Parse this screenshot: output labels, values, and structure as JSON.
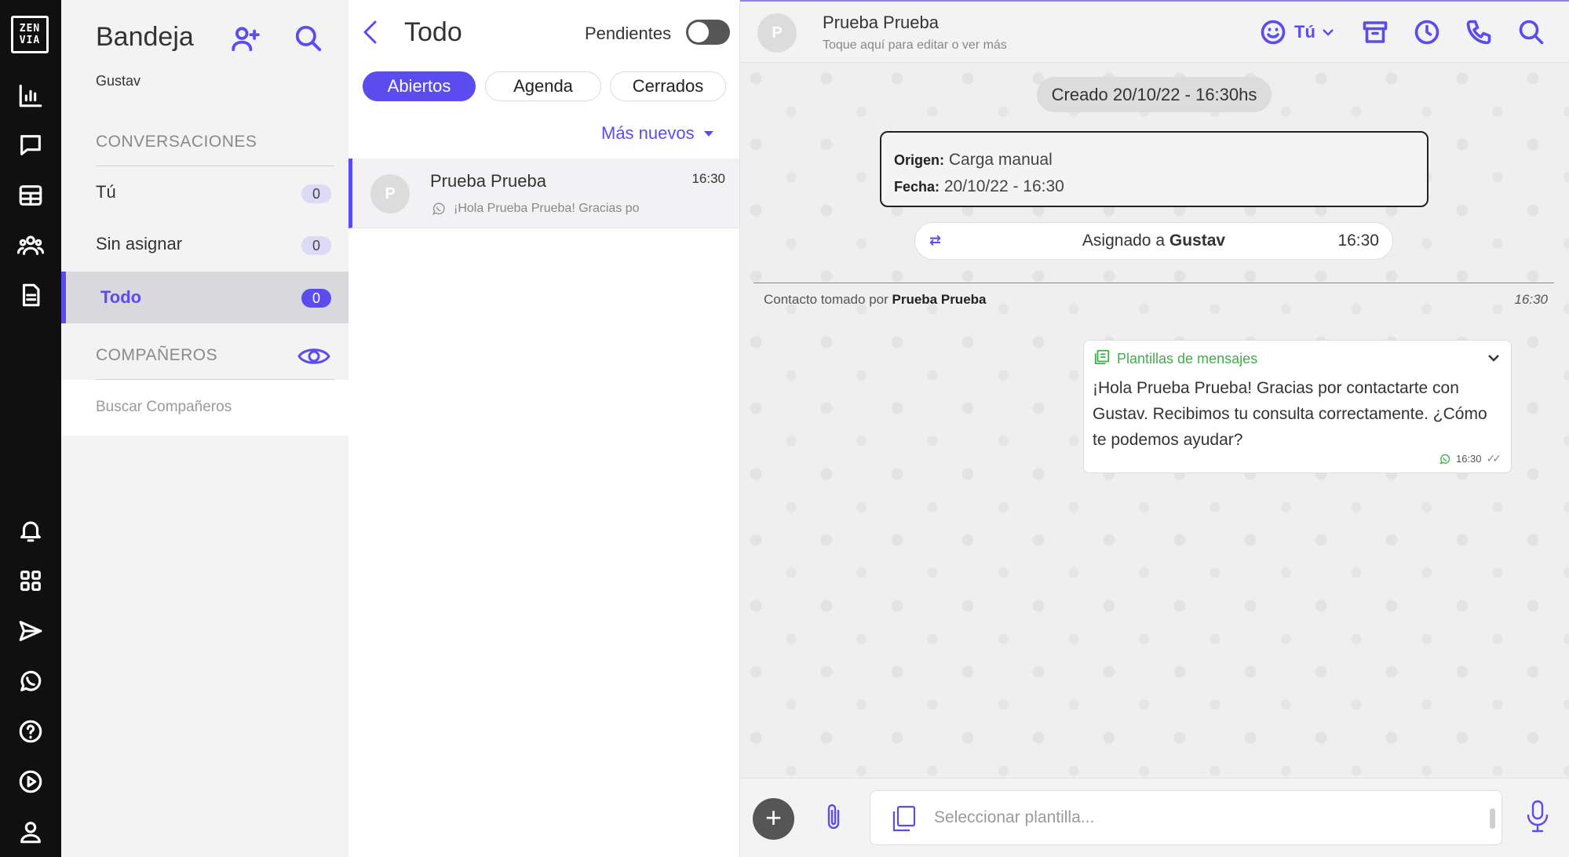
{
  "brand": {
    "logo_line1": "ZEN",
    "logo_line2": "VIA"
  },
  "rail": {
    "top_icons": [
      "logo-icon",
      "chart-icon",
      "chat-icon",
      "table-icon",
      "users-icon",
      "document-icon"
    ],
    "bottom_icons": [
      "bell-icon",
      "apps-icon",
      "send-icon",
      "whatsapp-icon",
      "help-icon",
      "play-icon",
      "user-icon"
    ]
  },
  "inbox": {
    "title": "Bandeja",
    "user": "Gustav",
    "conversations_header": "CONVERSACIONES",
    "items": [
      {
        "label": "Tú",
        "count": "0"
      },
      {
        "label": "Sin asignar",
        "count": "0"
      },
      {
        "label": "Todo",
        "count": "0"
      }
    ],
    "companions_header": "COMPAÑEROS",
    "search_companions": "Buscar Compañeros"
  },
  "list": {
    "title": "Todo",
    "pending_label": "Pendientes",
    "tabs": [
      {
        "label": "Abiertos"
      },
      {
        "label": "Agenda"
      },
      {
        "label": "Cerrados"
      }
    ],
    "sort_label": "Más nuevos",
    "conversation": {
      "initial": "P",
      "name": "Prueba Prueba",
      "time": "16:30",
      "preview": "¡Hola Prueba Prueba! Gracias po"
    }
  },
  "chat": {
    "initial": "P",
    "name": "Prueba Prueba",
    "subtitle": "Toque aquí para editar o ver más",
    "assignee_label": "Tú",
    "created": "Creado 20/10/22 - 16:30hs",
    "origin_label": "Origen:",
    "origin_value": "Carga manual",
    "date_label": "Fecha:",
    "date_value": "20/10/22 - 16:30",
    "assigned_prefix": "Asignado a",
    "assigned_name": "Gustav",
    "assigned_time": "16:30",
    "taken_prefix": "Contacto tomado por",
    "taken_name": "Prueba Prueba",
    "taken_time": "16:30",
    "message": {
      "header": "Plantillas de mensajes",
      "text": "¡Hola Prueba Prueba! Gracias por contactarte con Gustav. Recibimos tu consulta correctamente. ¿Cómo te podemos ayudar?",
      "time": "16:30"
    },
    "composer_placeholder": "Seleccionar plantilla..."
  },
  "colors": {
    "accent": "#5b4cf0",
    "rail": "#101010",
    "whatsapp_green": "#3fae49"
  }
}
